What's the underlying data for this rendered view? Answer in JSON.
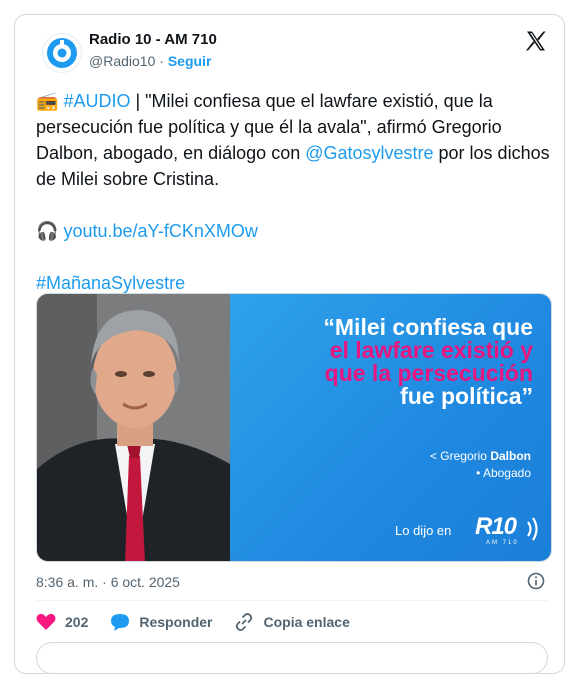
{
  "account": {
    "name": "Radio 10 - AM 710",
    "handle": "@Radio10",
    "separator": "·",
    "follow_label": "Seguir"
  },
  "tweet": {
    "radio_emoji": "📻",
    "hashtag_audio": "#AUDIO",
    "body_part1": " | \"Milei confiesa que el lawfare existió, que la persecución fue política y que él la avala\", afirmó Gregorio Dalbon, abogado, en diálogo con ",
    "mention": "@Gatosylvestre",
    "body_part2": " por los dichos de Milei sobre Cristina.",
    "headphones_emoji": "🎧",
    "link": "youtu.be/aY-fCKnXMOw",
    "hashtag_show": "#MañanaSylvestre"
  },
  "media": {
    "quote_line1": "“Milei confiesa que",
    "quote_line2": "el lawfare existió y",
    "quote_line3": "que la persecución",
    "quote_line4": "fue política”",
    "author_prefix": "< Gregorio ",
    "author_surname": "Dalbon",
    "author_role": "• Abogado",
    "footer_text": "Lo dijo en",
    "logo_text": "R10",
    "logo_sub": "AM 710",
    "colors": {
      "panel": "#1f88e0",
      "highlight": "#e8177f"
    }
  },
  "meta": {
    "timestamp": "8:36 a. m. · 6 oct. 2025"
  },
  "actions": {
    "likes": "202",
    "reply_label": "Responder",
    "copy_label": "Copia enlace"
  },
  "icons": [
    "radio10-logo-icon",
    "x-logo-icon",
    "info-icon",
    "heart-icon",
    "reply-bubble-icon",
    "link-icon"
  ]
}
